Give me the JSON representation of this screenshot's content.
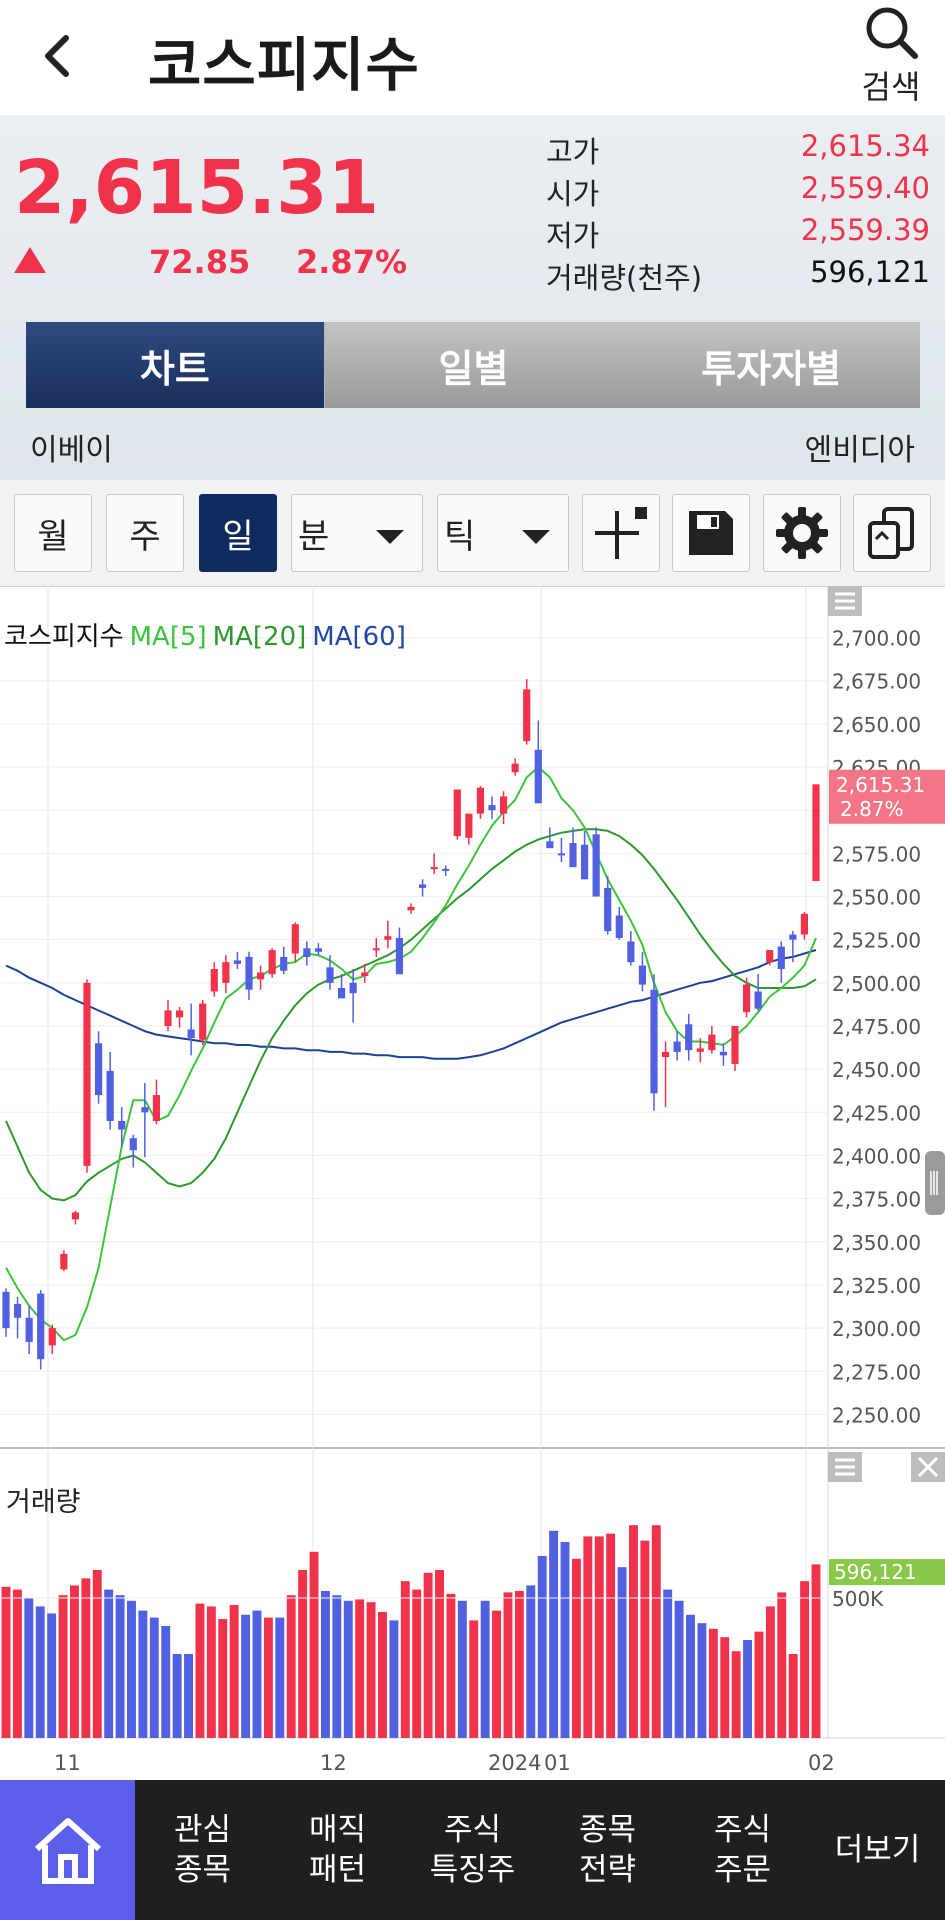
{
  "header": {
    "title": "코스피지수",
    "search_label": "검색"
  },
  "quote": {
    "price": "2,615.31",
    "change_amount": "72.85",
    "change_percent": "2.87%",
    "stats": [
      {
        "label": "고가",
        "value": "2,615.34",
        "tone": "up"
      },
      {
        "label": "시가",
        "value": "2,559.40",
        "tone": "up"
      },
      {
        "label": "저가",
        "value": "2,559.39",
        "tone": "up"
      },
      {
        "label": "거래량(천주)",
        "value": "596,121",
        "tone": "neutral"
      }
    ],
    "tabs": [
      "차트",
      "일별",
      "투자자별"
    ],
    "active_tab": 0,
    "prev_item": "이베이",
    "next_item": "엔비디아"
  },
  "toolbar": {
    "period_buttons": [
      "월",
      "주",
      "일"
    ],
    "active_period": "일",
    "minute_label": "분",
    "tick_label": "틱",
    "icons": [
      "crosshair-icon",
      "save-icon",
      "settings-gear-icon",
      "copy-screen-icon"
    ]
  },
  "chart_data": {
    "type": "candlestick",
    "legend": [
      {
        "text": "코스피지수",
        "color": "#111111"
      },
      {
        "text": "MA[5]",
        "color": "#3cc43c"
      },
      {
        "text": "MA[20]",
        "color": "#2e9a2e"
      },
      {
        "text": "MA[60]",
        "color": "#2348a8"
      }
    ],
    "ylim": [
      2237.5,
      2712.5
    ],
    "y_ticks": [
      "2,700.00",
      "2,675.00",
      "2,650.00",
      "2,625.00",
      "2,600.00",
      "2,575.00",
      "2,550.00",
      "2,525.00",
      "2,500.00",
      "2,475.00",
      "2,450.00",
      "2,425.00",
      "2,400.00",
      "2,375.00",
      "2,350.00",
      "2,325.00",
      "2,300.00",
      "2,275.00",
      "2,250.00"
    ],
    "x_labels": [
      "11",
      "12",
      "2024",
      "01",
      "02"
    ],
    "last_price_label": "2,615.31",
    "last_pct_label": "2.87%",
    "up_color": "#f0324b",
    "down_color": "#5060e0",
    "candles": [
      [
        2321,
        2323,
        2295,
        2300
      ],
      [
        2314,
        2318,
        2294,
        2306
      ],
      [
        2306,
        2313,
        2285,
        2292
      ],
      [
        2320,
        2322,
        2276,
        2282
      ],
      [
        2290,
        2302,
        2285,
        2300
      ],
      [
        2334,
        2345,
        2333,
        2343
      ],
      [
        2363,
        2368,
        2360,
        2367
      ],
      [
        2394,
        2502,
        2390,
        2500
      ],
      [
        2465,
        2472,
        2430,
        2435
      ],
      [
        2449,
        2460,
        2415,
        2420
      ],
      [
        2420,
        2428,
        2405,
        2415
      ],
      [
        2410,
        2412,
        2393,
        2403
      ],
      [
        2428,
        2442,
        2399,
        2425
      ],
      [
        2420,
        2444,
        2418,
        2435
      ],
      [
        2475,
        2490,
        2472,
        2484
      ],
      [
        2480,
        2486,
        2474,
        2484
      ],
      [
        2473,
        2488,
        2458,
        2468
      ],
      [
        2467,
        2490,
        2464,
        2488
      ],
      [
        2495,
        2512,
        2492,
        2508
      ],
      [
        2500,
        2516,
        2494,
        2512
      ],
      [
        2513,
        2518,
        2508,
        2511
      ],
      [
        2515,
        2518,
        2490,
        2496
      ],
      [
        2502,
        2510,
        2496,
        2506
      ],
      [
        2505,
        2520,
        2503,
        2519
      ],
      [
        2515,
        2521,
        2505,
        2507
      ],
      [
        2517,
        2535,
        2512,
        2534
      ],
      [
        2520,
        2524,
        2510,
        2515
      ],
      [
        2520,
        2523,
        2516,
        2518
      ],
      [
        2509,
        2516,
        2496,
        2500
      ],
      [
        2497,
        2505,
        2492,
        2491
      ],
      [
        2500,
        2508,
        2477,
        2494
      ],
      [
        2504,
        2511,
        2500,
        2506
      ],
      [
        2519,
        2526,
        2515,
        2520
      ],
      [
        2525,
        2536,
        2520,
        2527
      ],
      [
        2526,
        2532,
        2505,
        2505
      ],
      [
        2542,
        2546,
        2540,
        2544
      ],
      [
        2557,
        2560,
        2550,
        2555
      ],
      [
        2567,
        2575,
        2563,
        2567
      ],
      [
        2566,
        2568,
        2562,
        2565
      ],
      [
        2585,
        2610,
        2583,
        2612
      ],
      [
        2584,
        2598,
        2580,
        2598
      ],
      [
        2598,
        2614,
        2595,
        2613
      ],
      [
        2603,
        2608,
        2595,
        2600
      ],
      [
        2598,
        2611,
        2592,
        2608
      ],
      [
        2622,
        2630,
        2620,
        2627
      ],
      [
        2640,
        2676,
        2638,
        2670
      ],
      [
        2635,
        2652,
        2628,
        2604
      ],
      [
        2582,
        2590,
        2579,
        2578
      ],
      [
        2575,
        2584,
        2570,
        2574
      ],
      [
        2581,
        2590,
        2570,
        2567
      ],
      [
        2580,
        2588,
        2560,
        2560
      ],
      [
        2586,
        2590,
        2555,
        2550
      ],
      [
        2555,
        2562,
        2528,
        2530
      ],
      [
        2539,
        2544,
        2525,
        2526
      ],
      [
        2524,
        2530,
        2510,
        2512
      ],
      [
        2510,
        2518,
        2495,
        2499
      ],
      [
        2496,
        2505,
        2426,
        2436
      ],
      [
        2457,
        2466,
        2428,
        2460
      ],
      [
        2466,
        2472,
        2455,
        2460
      ],
      [
        2476,
        2482,
        2455,
        2461
      ],
      [
        2460,
        2468,
        2454,
        2462
      ],
      [
        2461,
        2475,
        2459,
        2470
      ],
      [
        2460,
        2465,
        2452,
        2458
      ],
      [
        2453,
        2472,
        2449,
        2475
      ],
      [
        2483,
        2503,
        2480,
        2499
      ],
      [
        2495,
        2505,
        2484,
        2485
      ],
      [
        2512,
        2519,
        2510,
        2519
      ],
      [
        2521,
        2524,
        2500,
        2508
      ],
      [
        2528,
        2530,
        2512,
        2525
      ],
      [
        2528,
        2541,
        2525,
        2540
      ],
      [
        2559,
        2615,
        2559,
        2615
      ]
    ],
    "ma5": [
      2335,
      2323,
      2313,
      2305,
      2300,
      2293,
      2296,
      2312,
      2335,
      2370,
      2405,
      2432,
      2432,
      2420,
      2423,
      2435,
      2449,
      2462,
      2477,
      2491,
      2496,
      2502,
      2504,
      2508,
      2511,
      2512,
      2517,
      2516,
      2513,
      2508,
      2502,
      2504,
      2511,
      2512,
      2514,
      2518,
      2526,
      2535,
      2545,
      2557,
      2568,
      2580,
      2591,
      2599,
      2606,
      2619,
      2625,
      2619,
      2607,
      2600,
      2590,
      2575,
      2560,
      2548,
      2536,
      2522,
      2500,
      2483,
      2472,
      2466,
      2466,
      2465,
      2464,
      2469,
      2475,
      2483,
      2492,
      2497,
      2503,
      2510,
      2526
    ],
    "ma20": [
      2420,
      2405,
      2390,
      2380,
      2375,
      2374,
      2377,
      2385,
      2390,
      2394,
      2398,
      2400,
      2396,
      2390,
      2384,
      2382,
      2384,
      2390,
      2398,
      2410,
      2425,
      2440,
      2455,
      2468,
      2478,
      2487,
      2494,
      2499,
      2502,
      2504,
      2507,
      2510,
      2513,
      2516,
      2520,
      2525,
      2531,
      2537,
      2543,
      2549,
      2554,
      2560,
      2566,
      2571,
      2576,
      2580,
      2583,
      2585,
      2587,
      2588,
      2589,
      2589,
      2588,
      2585,
      2580,
      2574,
      2566,
      2557,
      2548,
      2538,
      2528,
      2519,
      2511,
      2504,
      2500,
      2497,
      2497,
      2497,
      2497,
      2498,
      2502
    ],
    "ma60": [
      2510,
      2507,
      2503,
      2500,
      2497,
      2493,
      2490,
      2487,
      2484,
      2481,
      2478,
      2475,
      2472,
      2470,
      2469,
      2468,
      2467,
      2466,
      2465,
      2465,
      2464,
      2464,
      2463,
      2463,
      2462,
      2462,
      2461,
      2461,
      2460,
      2460,
      2459,
      2459,
      2458,
      2458,
      2457,
      2457,
      2457,
      2456,
      2456,
      2456,
      2457,
      2458,
      2460,
      2462,
      2465,
      2468,
      2471,
      2474,
      2477,
      2479,
      2481,
      2483,
      2485,
      2487,
      2489,
      2490,
      2492,
      2494,
      2496,
      2498,
      2500,
      2501,
      2503,
      2505,
      2507,
      2509,
      2512,
      2514,
      2515,
      2517,
      2519
    ],
    "volume": {
      "title": "거래량",
      "ylim": [
        0,
        1000000
      ],
      "tick_label": "500K",
      "last_label": "596,121",
      "values": [
        540000,
        530000,
        500000,
        470000,
        445000,
        510000,
        545000,
        570000,
        600000,
        530000,
        510000,
        490000,
        455000,
        430000,
        400000,
        300000,
        300000,
        480000,
        470000,
        425000,
        475000,
        440000,
        455000,
        430000,
        430000,
        510000,
        600000,
        665000,
        525000,
        510000,
        490000,
        495000,
        485000,
        450000,
        420000,
        560000,
        530000,
        590000,
        600000,
        515000,
        490000,
        420000,
        490000,
        455000,
        520000,
        525000,
        545000,
        650000,
        740000,
        700000,
        640000,
        720000,
        720000,
        730000,
        610000,
        760000,
        705000,
        760000,
        530000,
        490000,
        440000,
        410000,
        390000,
        360000,
        310000,
        350000,
        380000,
        470000,
        520000,
        300000,
        560000,
        620000
      ],
      "vol_up": [
        1,
        1,
        0,
        0,
        0,
        1,
        1,
        1,
        1,
        0,
        0,
        0,
        0,
        0,
        0,
        0,
        0,
        1,
        1,
        1,
        1,
        0,
        0,
        1,
        0,
        1,
        1,
        1,
        0,
        0,
        0,
        1,
        1,
        1,
        0,
        1,
        1,
        1,
        1,
        1,
        0,
        1,
        0,
        1,
        1,
        1,
        0,
        0,
        0,
        0,
        1,
        1,
        1,
        1,
        0,
        1,
        1,
        1,
        0,
        0,
        0,
        0,
        1,
        1,
        1,
        0,
        1,
        1,
        1,
        1,
        1,
        1
      ]
    }
  },
  "nav": {
    "home_icon": "home-icon",
    "items": [
      "관심\n종목",
      "매직\n패턴",
      "주식\n특징주",
      "종목\n전략",
      "주식\n주문",
      "더보기"
    ]
  }
}
